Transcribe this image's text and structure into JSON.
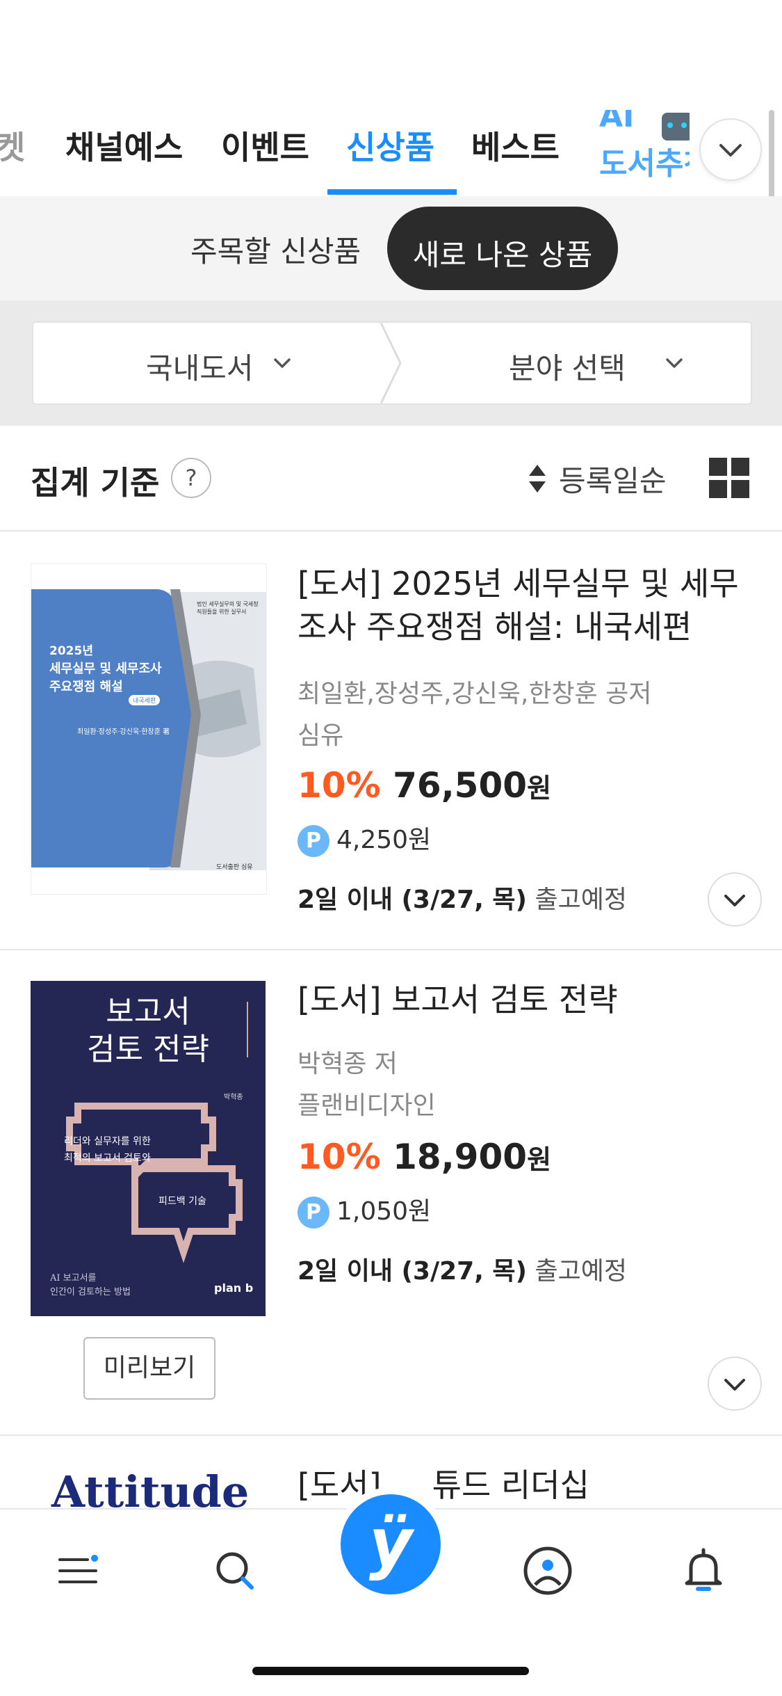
{
  "top_tabs": {
    "items": [
      {
        "label": "켓"
      },
      {
        "label": "채널예스"
      },
      {
        "label": "이벤트"
      },
      {
        "label": "신상품"
      },
      {
        "label": "베스트"
      }
    ],
    "active_index": 3,
    "ai_tab_label": "AI",
    "ai_tab_sublabel": "도서추천",
    "accent_color": "#1a8cff"
  },
  "sub_tabs": {
    "items": [
      {
        "label": "주목할 신상품"
      },
      {
        "label": "새로 나온 상품"
      }
    ],
    "active_index": 1
  },
  "filters": {
    "category": "국내도서",
    "field": "분야 선택"
  },
  "summary": {
    "title": "집계 기준",
    "help": "?",
    "sort_label": "등록일순"
  },
  "products": [
    {
      "title": "[도서] 2025년 세무실무 및 세무조사 주요쟁점 해설: 내국세편",
      "author": "최일환,장성주,강신욱,한창훈 공저",
      "publisher": "심유",
      "discount": "10%",
      "price": "76,500",
      "currency": "원",
      "point": "4,250원",
      "shipping_bold": "2일 이내 (3/27, 목)",
      "shipping_text": "출고예정",
      "cover": {
        "small_top": "법인 세무실무의 및 국세청 직원들을 위한 실무서",
        "year": "2025년",
        "line1": "세무실무 및 세무조사",
        "line2": "주요쟁점 해설",
        "badge": "내국세편",
        "authors": "최일환·장성주·강신욱·한창훈 著",
        "publisher": "도서출판 심유"
      }
    },
    {
      "title": "[도서] 보고서 검토 전략",
      "author": "박혁종 저",
      "publisher": "플랜비디자인",
      "discount": "10%",
      "price": "18,900",
      "currency": "원",
      "point": "1,050원",
      "shipping_bold": "2일 이내 (3/27, 목)",
      "shipping_text": "출고예정",
      "preview_label": "미리보기",
      "cover": {
        "line1": "보고서",
        "line2": "검토 전략",
        "author": "박혁종",
        "sub1": "리더와 실무자를 위한",
        "sub2": "최적의 보고서 검토와",
        "sub3": "피드백 기술",
        "bottom1": "AI 보고서를",
        "bottom2": "인간이 검토하는 방법",
        "logo": "plan b"
      }
    },
    {
      "title_prefix": "[도서]",
      "title_suffix": "튜드 리더십",
      "cover": {
        "text": "Attitude"
      }
    }
  ],
  "bottom_nav": {
    "home_glyph": "ÿ",
    "accent_color": "#1a8cff"
  }
}
